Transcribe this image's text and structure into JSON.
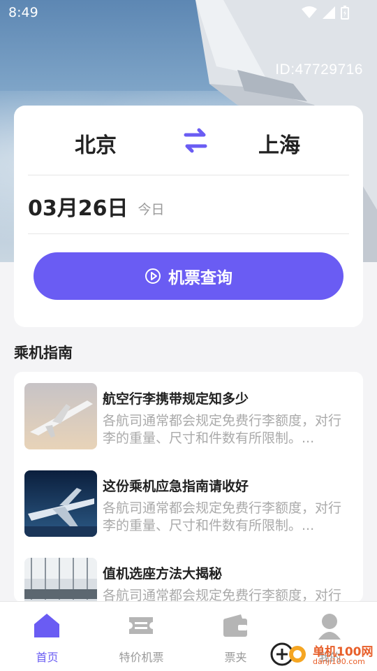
{
  "status_bar": {
    "time": "8:49"
  },
  "user": {
    "id_label": "ID:47729716"
  },
  "search": {
    "from_city": "北京",
    "to_city": "上海",
    "date": "03月26日",
    "date_hint": "今日",
    "button_label": "机票查询",
    "accent_color": "#6a5cf3"
  },
  "guide": {
    "section_title": "乘机指南",
    "items": [
      {
        "title": "航空行李携带规定知多少",
        "desc": "各航司通常都会规定免费行李额度，对行李的重量、尺寸和件数有所限制。..."
      },
      {
        "title": "这份乘机应急指南请收好",
        "desc": "各航司通常都会规定免费行李额度，对行李的重量、尺寸和件数有所限制。..."
      },
      {
        "title": "值机选座方法大揭秘",
        "desc": "各航司通常都会规定免费行李额度，对行李的重量、尺寸和件数有所限制。..."
      }
    ]
  },
  "bottom_nav": {
    "items": [
      {
        "label": "首页",
        "icon": "home-icon",
        "active": true
      },
      {
        "label": "特价机票",
        "icon": "ticket-icon",
        "active": false
      },
      {
        "label": "票夹",
        "icon": "wallet-icon",
        "active": false
      },
      {
        "label": "我的",
        "icon": "profile-icon",
        "active": false
      }
    ]
  },
  "watermark": {
    "text": "单机100网",
    "sub": "danji100.com"
  }
}
